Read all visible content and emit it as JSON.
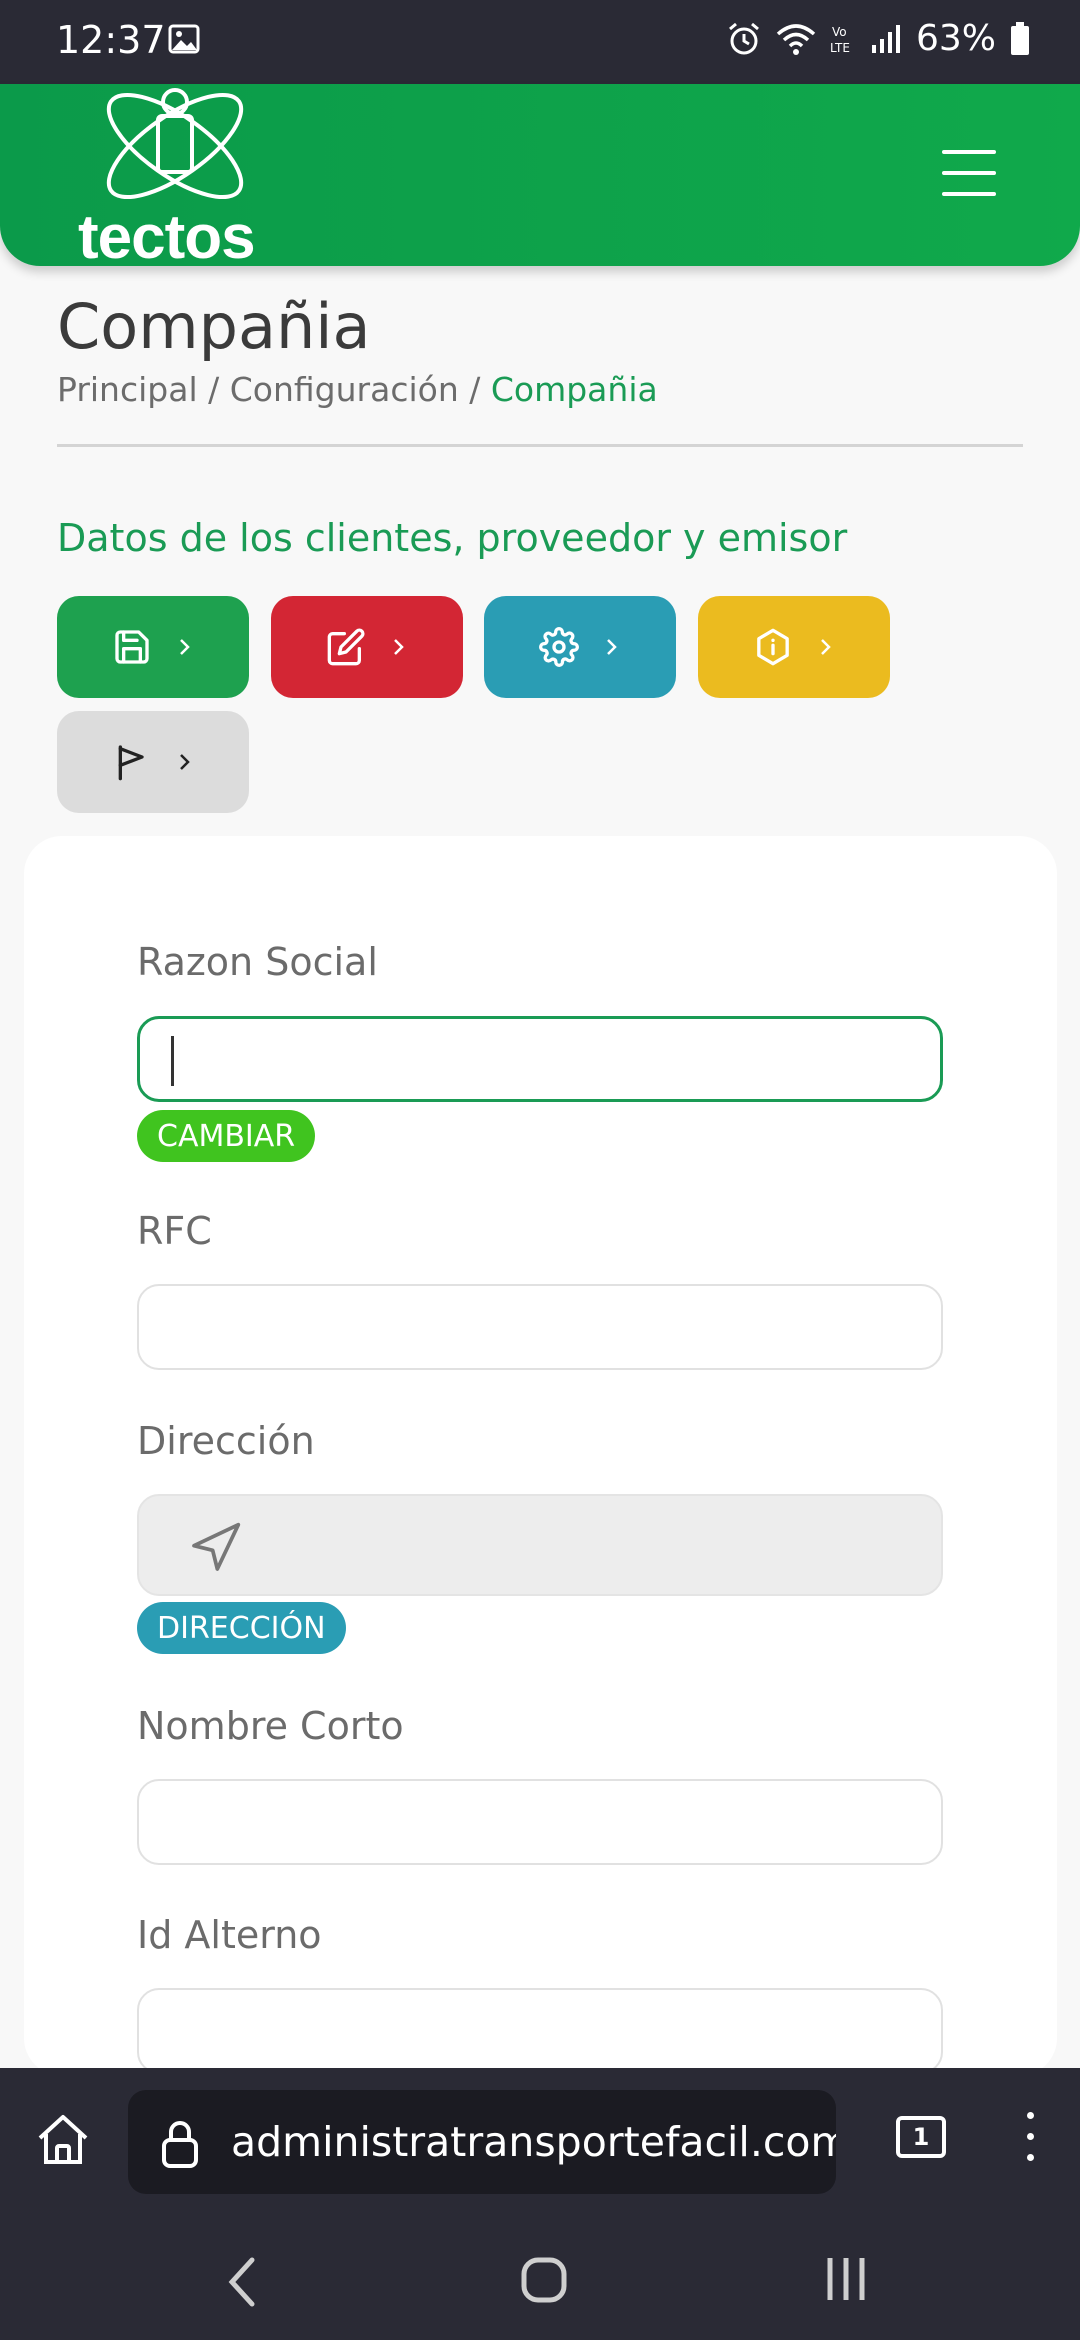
{
  "status_bar": {
    "time": "12:37",
    "battery": "63%"
  },
  "header": {
    "logo_text": "tectos"
  },
  "page": {
    "title": "Compañia",
    "breadcrumb": {
      "item1": "Principal",
      "sep1": " / ",
      "item2": "Configuración",
      "sep2": " / ",
      "active": "Compañia"
    },
    "section_title": "Datos de los clientes, proveedor y emisor"
  },
  "action_buttons": [
    {
      "icon": "save-icon",
      "color": "#1ea14f"
    },
    {
      "icon": "edit-icon",
      "color": "#d32634"
    },
    {
      "icon": "gear-icon",
      "color": "#2a9db4"
    },
    {
      "icon": "info-icon",
      "color": "#ebbb1f"
    },
    {
      "icon": "flag-icon",
      "color": "#dcdcdc"
    }
  ],
  "form": {
    "razon_social": {
      "label": "Razon Social",
      "value": ""
    },
    "cambiar_label": "CAMBIAR",
    "rfc": {
      "label": "RFC",
      "value": ""
    },
    "direccion": {
      "label": "Dirección",
      "value": ""
    },
    "direccion_button": "DIRECCIÓN",
    "nombre_corto": {
      "label": "Nombre Corto",
      "value": ""
    },
    "id_alterno": {
      "label": "Id Alterno",
      "value": ""
    }
  },
  "browser": {
    "url": "administratransportefacil.com/s",
    "tab_count": "1"
  },
  "colors": {
    "brand_green": "#10a94b",
    "accent_green": "#1a9b55",
    "danger": "#d32634",
    "info": "#2a9db4",
    "warning": "#ebbb1f",
    "pill_green": "#40c41f"
  }
}
